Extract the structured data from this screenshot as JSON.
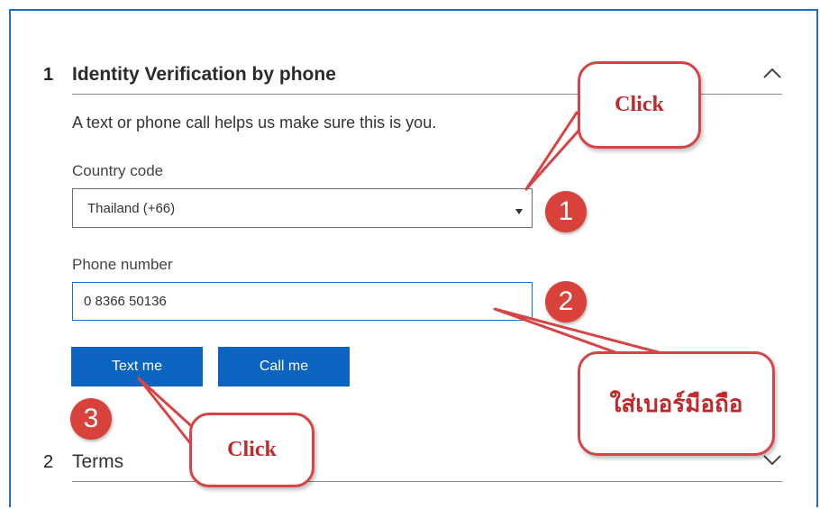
{
  "section1": {
    "number": "1",
    "title": "Identity Verification by phone",
    "description": "A text or phone call helps us make sure this is you."
  },
  "country": {
    "label": "Country code",
    "value": "Thailand (+66)"
  },
  "phone": {
    "label": "Phone number",
    "value": "0 8366 50136"
  },
  "buttons": {
    "text_me": "Text me",
    "call_me": "Call me"
  },
  "section2": {
    "number": "2",
    "title": "Terms"
  },
  "annotations": {
    "callout1": "Click",
    "callout2": "ใส่เบอร์มือถือ",
    "callout3": "Click",
    "badge1": "1",
    "badge2": "2",
    "badge3": "3"
  },
  "colors": {
    "primary": "#0b64c0",
    "callout_border": "#d64545",
    "badge": "#d9413b",
    "frame": "#1f6fc9"
  }
}
